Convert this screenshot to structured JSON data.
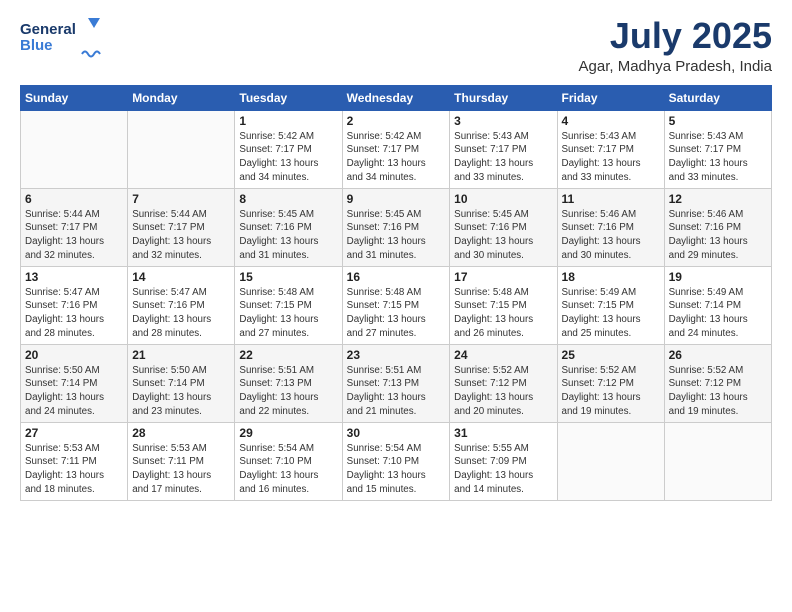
{
  "header": {
    "logo_line1": "General",
    "logo_line2": "Blue",
    "month": "July 2025",
    "location": "Agar, Madhya Pradesh, India"
  },
  "weekdays": [
    "Sunday",
    "Monday",
    "Tuesday",
    "Wednesday",
    "Thursday",
    "Friday",
    "Saturday"
  ],
  "weeks": [
    [
      {
        "day": "",
        "info": ""
      },
      {
        "day": "",
        "info": ""
      },
      {
        "day": "1",
        "info": "Sunrise: 5:42 AM\nSunset: 7:17 PM\nDaylight: 13 hours\nand 34 minutes."
      },
      {
        "day": "2",
        "info": "Sunrise: 5:42 AM\nSunset: 7:17 PM\nDaylight: 13 hours\nand 34 minutes."
      },
      {
        "day": "3",
        "info": "Sunrise: 5:43 AM\nSunset: 7:17 PM\nDaylight: 13 hours\nand 33 minutes."
      },
      {
        "day": "4",
        "info": "Sunrise: 5:43 AM\nSunset: 7:17 PM\nDaylight: 13 hours\nand 33 minutes."
      },
      {
        "day": "5",
        "info": "Sunrise: 5:43 AM\nSunset: 7:17 PM\nDaylight: 13 hours\nand 33 minutes."
      }
    ],
    [
      {
        "day": "6",
        "info": "Sunrise: 5:44 AM\nSunset: 7:17 PM\nDaylight: 13 hours\nand 32 minutes."
      },
      {
        "day": "7",
        "info": "Sunrise: 5:44 AM\nSunset: 7:17 PM\nDaylight: 13 hours\nand 32 minutes."
      },
      {
        "day": "8",
        "info": "Sunrise: 5:45 AM\nSunset: 7:16 PM\nDaylight: 13 hours\nand 31 minutes."
      },
      {
        "day": "9",
        "info": "Sunrise: 5:45 AM\nSunset: 7:16 PM\nDaylight: 13 hours\nand 31 minutes."
      },
      {
        "day": "10",
        "info": "Sunrise: 5:45 AM\nSunset: 7:16 PM\nDaylight: 13 hours\nand 30 minutes."
      },
      {
        "day": "11",
        "info": "Sunrise: 5:46 AM\nSunset: 7:16 PM\nDaylight: 13 hours\nand 30 minutes."
      },
      {
        "day": "12",
        "info": "Sunrise: 5:46 AM\nSunset: 7:16 PM\nDaylight: 13 hours\nand 29 minutes."
      }
    ],
    [
      {
        "day": "13",
        "info": "Sunrise: 5:47 AM\nSunset: 7:16 PM\nDaylight: 13 hours\nand 28 minutes."
      },
      {
        "day": "14",
        "info": "Sunrise: 5:47 AM\nSunset: 7:16 PM\nDaylight: 13 hours\nand 28 minutes."
      },
      {
        "day": "15",
        "info": "Sunrise: 5:48 AM\nSunset: 7:15 PM\nDaylight: 13 hours\nand 27 minutes."
      },
      {
        "day": "16",
        "info": "Sunrise: 5:48 AM\nSunset: 7:15 PM\nDaylight: 13 hours\nand 27 minutes."
      },
      {
        "day": "17",
        "info": "Sunrise: 5:48 AM\nSunset: 7:15 PM\nDaylight: 13 hours\nand 26 minutes."
      },
      {
        "day": "18",
        "info": "Sunrise: 5:49 AM\nSunset: 7:15 PM\nDaylight: 13 hours\nand 25 minutes."
      },
      {
        "day": "19",
        "info": "Sunrise: 5:49 AM\nSunset: 7:14 PM\nDaylight: 13 hours\nand 24 minutes."
      }
    ],
    [
      {
        "day": "20",
        "info": "Sunrise: 5:50 AM\nSunset: 7:14 PM\nDaylight: 13 hours\nand 24 minutes."
      },
      {
        "day": "21",
        "info": "Sunrise: 5:50 AM\nSunset: 7:14 PM\nDaylight: 13 hours\nand 23 minutes."
      },
      {
        "day": "22",
        "info": "Sunrise: 5:51 AM\nSunset: 7:13 PM\nDaylight: 13 hours\nand 22 minutes."
      },
      {
        "day": "23",
        "info": "Sunrise: 5:51 AM\nSunset: 7:13 PM\nDaylight: 13 hours\nand 21 minutes."
      },
      {
        "day": "24",
        "info": "Sunrise: 5:52 AM\nSunset: 7:12 PM\nDaylight: 13 hours\nand 20 minutes."
      },
      {
        "day": "25",
        "info": "Sunrise: 5:52 AM\nSunset: 7:12 PM\nDaylight: 13 hours\nand 19 minutes."
      },
      {
        "day": "26",
        "info": "Sunrise: 5:52 AM\nSunset: 7:12 PM\nDaylight: 13 hours\nand 19 minutes."
      }
    ],
    [
      {
        "day": "27",
        "info": "Sunrise: 5:53 AM\nSunset: 7:11 PM\nDaylight: 13 hours\nand 18 minutes."
      },
      {
        "day": "28",
        "info": "Sunrise: 5:53 AM\nSunset: 7:11 PM\nDaylight: 13 hours\nand 17 minutes."
      },
      {
        "day": "29",
        "info": "Sunrise: 5:54 AM\nSunset: 7:10 PM\nDaylight: 13 hours\nand 16 minutes."
      },
      {
        "day": "30",
        "info": "Sunrise: 5:54 AM\nSunset: 7:10 PM\nDaylight: 13 hours\nand 15 minutes."
      },
      {
        "day": "31",
        "info": "Sunrise: 5:55 AM\nSunset: 7:09 PM\nDaylight: 13 hours\nand 14 minutes."
      },
      {
        "day": "",
        "info": ""
      },
      {
        "day": "",
        "info": ""
      }
    ]
  ]
}
